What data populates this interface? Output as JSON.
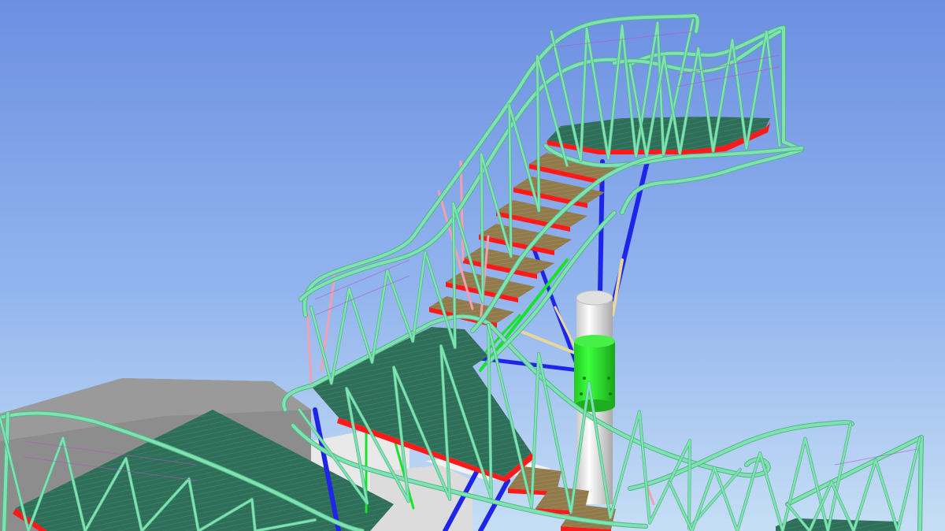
{
  "viewport": {
    "kind": "3d-cad-model-view",
    "subject": "spiral-stair-with-truss-railings",
    "background_gradient": [
      "#6e93e3",
      "#c9e2f4"
    ]
  },
  "colors": {
    "railing": "#7ee3b0",
    "railing_dark": "#52b486",
    "tread_wood": "#8f7a4e",
    "tread_nosing": "#ff1a1a",
    "landing_deck": "#2d6b57",
    "stringer_blue": "#1f25e8",
    "brace_green": "#16e32a",
    "brace_pink": "#f2a0b0",
    "brace_tan": "#e8d79a",
    "column_light": "#f4f4f4",
    "column_shade": "#b9b9b9",
    "column_band": "#2ee02e",
    "ground_slab": "#8c8c8c",
    "block_light": "#ececec"
  }
}
